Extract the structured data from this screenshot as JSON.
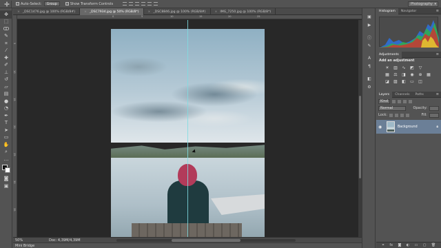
{
  "options_bar": {
    "auto_select_label": "Auto-Select:",
    "auto_select_value": "Group",
    "show_transform_label": "Show Transform Controls",
    "workspace": "Photography"
  },
  "tabs": [
    {
      "label": "_DSC1476.jpg @ 100% (RGB/8#)",
      "active": false
    },
    {
      "label": "_DSC7934.jpg @ 50% (RGB/8*)",
      "active": true
    },
    {
      "label": "_DSC8846.jpg @ 100% (RGB/8#)",
      "active": false
    },
    {
      "label": "IMG_7250.jpg @ 100% (RGB/8*)",
      "active": false
    }
  ],
  "ruler": {
    "top_ticks": [
      "0",
      "5",
      "10",
      "15",
      "20",
      "25"
    ],
    "left_ticks": [
      "5",
      "10",
      "15",
      "20",
      "25",
      "30",
      "35"
    ]
  },
  "status": {
    "zoom": "50%",
    "doc_info": "Doc: 4,39M/4,39M"
  },
  "mini_bridge": "Mini Bridge",
  "panels": {
    "histogram_tab": "Histogram",
    "navigator_tab": "Navigator",
    "adjustments_tab": "Adjustments",
    "add_adjustment_label": "Add an adjustment",
    "layers_tab": "Layers",
    "channels_tab": "Channels",
    "paths_tab": "Paths",
    "kind_label": "Kind",
    "blend_mode": "Normal",
    "opacity_label": "Opacity:",
    "lock_label": "Lock:",
    "fill_label": "Fill:",
    "layer_name": "Background"
  },
  "colors": {
    "guide": "#7fdde2",
    "active_layer": "#6b7f97"
  }
}
